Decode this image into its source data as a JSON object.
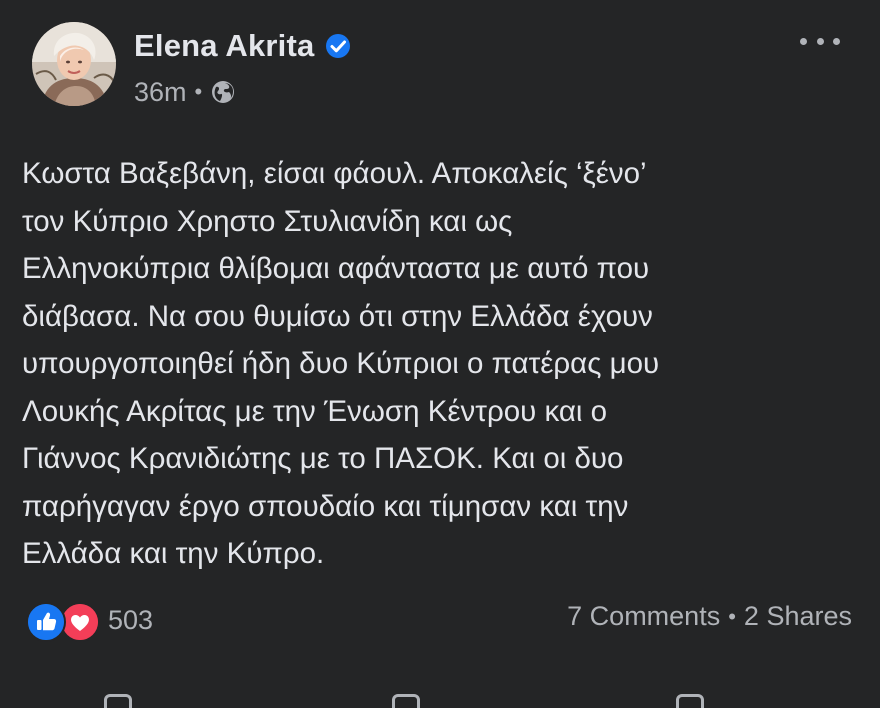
{
  "post": {
    "author": "Elena Akrita",
    "time": "36m",
    "text_lines": [
      "Κωστα Βαξεβάνη, είσαι φάουλ. Αποκαλείς ‘ξένο’",
      "τον Κύπριο Χρηστο Στυλιανίδη και ως",
      "Ελληνοκύπρια θλίβομαι αφάνταστα με αυτό που",
      "διάβασα. Να σου θυμίσω ότι στην Ελλάδα έχουν",
      "υπουργοποιηθεί ήδη δυο Κύπριοι ο πατέρας μου",
      "Λουκής Ακρίτας με την Ένωση Κέντρου και ο",
      "Γιάννος Κρανιδιώτης με το ΠΑΣΟΚ. Και οι δυο",
      "παρήγαγαν έργο σπουδαίο και τίμησαν και την",
      "Ελλάδα και την Κύπρο."
    ],
    "reaction_count": "503",
    "comments": "7 Comments",
    "shares": "2 Shares",
    "meta_separator": "•"
  },
  "icons": {
    "verified": "verified-badge-icon",
    "audience": "globe-icon",
    "more": "more-options-icon",
    "like": "like-reaction-icon",
    "love": "love-reaction-icon"
  },
  "colors": {
    "background": "#242526",
    "primary_text": "#e4e6eb",
    "secondary_text": "#b0b3b8",
    "verified": "#1877f2",
    "like": "#1877f2",
    "love": "#f33e58"
  }
}
